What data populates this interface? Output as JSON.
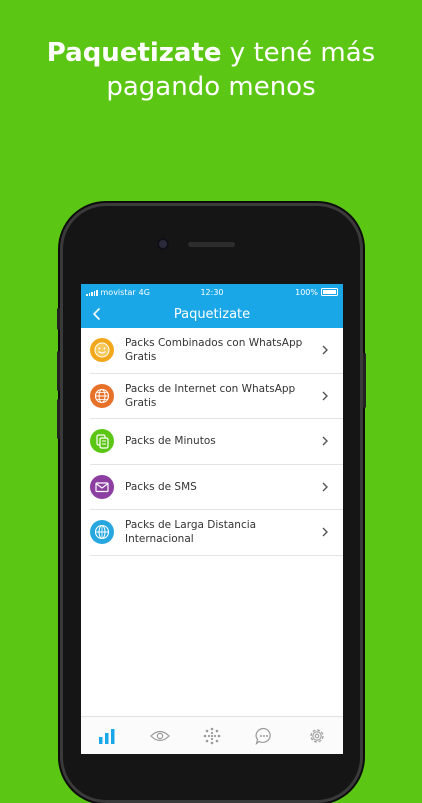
{
  "headline": {
    "bold": "Paquetizate",
    "rest_line1": " y tené más",
    "line2": "pagando menos"
  },
  "status_bar": {
    "carrier": "movistar",
    "network": "4G",
    "time": "12:30",
    "battery": "100%"
  },
  "nav": {
    "title": "Paquetizate"
  },
  "items": [
    {
      "label": "Packs Combinados con WhatsApp Gratis",
      "icon": "smiley-icon",
      "color": "#f2a81d"
    },
    {
      "label": "Packs de Internet con WhatsApp Gratis",
      "icon": "globe-icon",
      "color": "#e8712a"
    },
    {
      "label": "Packs de Minutos",
      "icon": "phone-icon",
      "color": "#5cc614"
    },
    {
      "label": "Packs de SMS",
      "icon": "envelope-icon",
      "color": "#8c3fa0"
    },
    {
      "label": "Packs de Larga Distancia Internacional",
      "icon": "world-icon",
      "color": "#27a7e0"
    }
  ],
  "tabs": [
    {
      "icon": "bar-chart-icon",
      "active": true
    },
    {
      "icon": "eye-icon",
      "active": false
    },
    {
      "icon": "dots-circle-icon",
      "active": false
    },
    {
      "icon": "chat-bubble-icon",
      "active": false
    },
    {
      "icon": "gear-icon",
      "active": false
    }
  ],
  "colors": {
    "background": "#5cc614",
    "accent": "#1aa7e8"
  }
}
